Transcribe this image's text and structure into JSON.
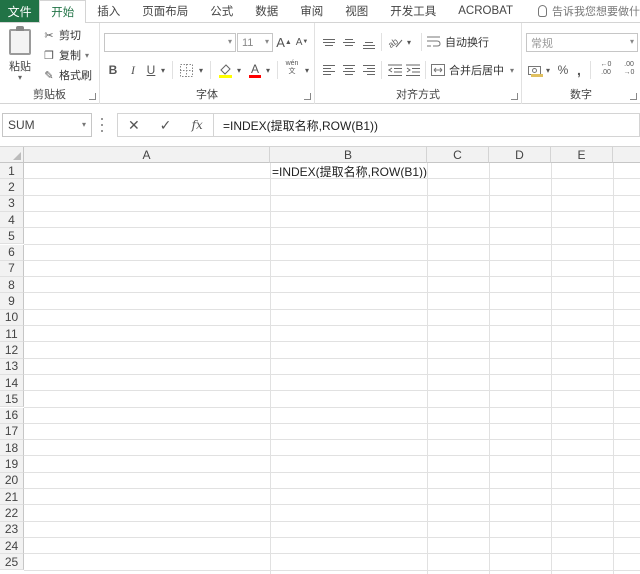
{
  "ribbon": {
    "tabs": [
      {
        "label": "文件",
        "active": false,
        "is_file": true
      },
      {
        "label": "开始",
        "active": true
      },
      {
        "label": "插入",
        "active": false
      },
      {
        "label": "页面布局",
        "active": false
      },
      {
        "label": "公式",
        "active": false
      },
      {
        "label": "数据",
        "active": false
      },
      {
        "label": "审阅",
        "active": false
      },
      {
        "label": "视图",
        "active": false
      },
      {
        "label": "开发工具",
        "active": false
      },
      {
        "label": "ACROBAT",
        "active": false
      }
    ],
    "tell_me": "告诉我您想要做什",
    "clipboard": {
      "paste": "粘贴",
      "cut": "剪切",
      "copy": "复制",
      "format_painter": "格式刷",
      "group_label": "剪贴板"
    },
    "font": {
      "font_name": "",
      "font_size": "11",
      "bold": "B",
      "italic": "I",
      "underline": "U",
      "grow": "A",
      "shrink": "A",
      "color_a": "A",
      "wen": "wén 文",
      "group_label": "字体"
    },
    "alignment": {
      "wrap_text": "自动换行",
      "merge_center": "合并后居中",
      "group_label": "对齐方式"
    },
    "number": {
      "format": "常规",
      "percent": "%",
      "comma": ",",
      "inc_decimal": "←0 .00",
      "dec_decimal": ".00 →0",
      "group_label": "数字"
    }
  },
  "formula_bar": {
    "name_box": "SUM",
    "cancel": "✕",
    "enter": "✓",
    "fx": "fx",
    "formula": "=INDEX(提取名称,ROW(B1))"
  },
  "sheet": {
    "columns": [
      "A",
      "B",
      "C",
      "D",
      "E"
    ],
    "rows": [
      "1",
      "2",
      "3",
      "4",
      "5",
      "6",
      "7",
      "8",
      "9",
      "10",
      "11",
      "12",
      "13",
      "14",
      "15",
      "16",
      "17",
      "18",
      "19",
      "20",
      "21",
      "22",
      "23",
      "24",
      "25"
    ],
    "cell_b1": "=INDEX(提取名称,ROW(B1))"
  }
}
